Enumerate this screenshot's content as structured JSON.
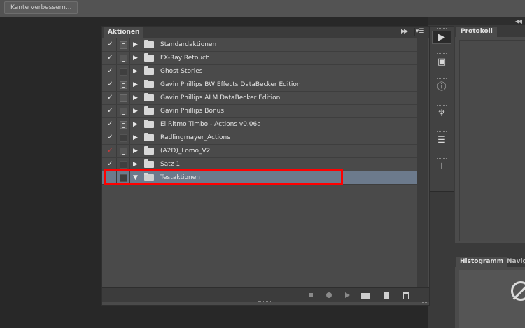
{
  "toolbar": {
    "refine_edge_label": "Kante verbessern..."
  },
  "actions_panel": {
    "tab_label": "Aktionen",
    "items": [
      {
        "label": "Standardaktionen",
        "checked": "✓",
        "check_color": "white",
        "dialog": "on",
        "state": "collapsed",
        "selected": false
      },
      {
        "label": "FX-Ray Retouch",
        "checked": "✓",
        "check_color": "white",
        "dialog": "on",
        "state": "collapsed",
        "selected": false
      },
      {
        "label": "Ghost Stories",
        "checked": "✓",
        "check_color": "white",
        "dialog": "off",
        "state": "collapsed",
        "selected": false
      },
      {
        "label": "Gavin Phillips BW Effects DataBecker Edition",
        "checked": "✓",
        "check_color": "white",
        "dialog": "on",
        "state": "collapsed",
        "selected": false
      },
      {
        "label": "Gavin Phillips ALM DataBecker Edition",
        "checked": "✓",
        "check_color": "white",
        "dialog": "on",
        "state": "collapsed",
        "selected": false
      },
      {
        "label": "Gavin Phillips  Bonus",
        "checked": "✓",
        "check_color": "white",
        "dialog": "on",
        "state": "collapsed",
        "selected": false
      },
      {
        "label": "El Ritmo Timbo - Actions v0.06a",
        "checked": "✓",
        "check_color": "white",
        "dialog": "on",
        "state": "collapsed",
        "selected": false
      },
      {
        "label": "Radlingmayer_Actions",
        "checked": "✓",
        "check_color": "white",
        "dialog": "off",
        "state": "collapsed",
        "selected": false
      },
      {
        "label": "(A2D)_Lomo_V2",
        "checked": "✓",
        "check_color": "red",
        "dialog": "on",
        "state": "collapsed",
        "selected": false
      },
      {
        "label": "Satz 1",
        "checked": "✓",
        "check_color": "white",
        "dialog": "off",
        "state": "collapsed",
        "selected": false
      },
      {
        "label": "Testaktionen",
        "checked": "",
        "check_color": "white",
        "dialog": "off",
        "state": "expanded",
        "selected": true
      }
    ]
  },
  "history_panel": {
    "tab_label": "Protokoll"
  },
  "histogram_panel": {
    "tab_label": "Histogramm",
    "tab2_label": "Navig"
  },
  "colors": {
    "selection": "#6c7a8c",
    "highlight": "#ff0000"
  }
}
